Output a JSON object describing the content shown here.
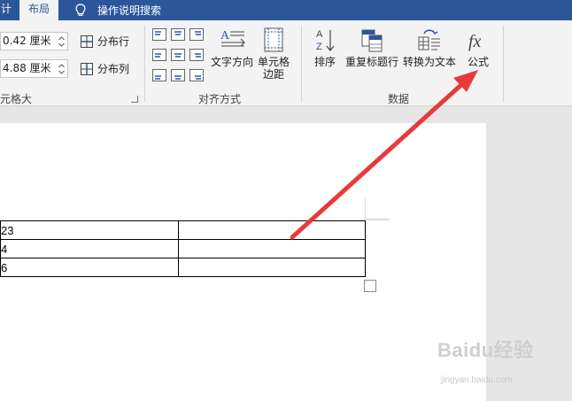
{
  "tabs": {
    "previous_partial": "计",
    "active": "布局",
    "tell_me": "操作说明搜索"
  },
  "cell_size": {
    "row_height": "0.42 厘米",
    "col_width": "4.88 厘米",
    "distribute_rows": "分布行",
    "distribute_cols": "分布列",
    "group_label": "元格大小"
  },
  "alignment": {
    "text_direction": "文字方向",
    "cell_margins_line1": "单元格",
    "cell_margins_line2": "边距",
    "group_label": "对齐方式"
  },
  "data_group": {
    "sort": "排序",
    "repeat_header": "重复标题行",
    "convert_to_text": "转换为文本",
    "formula": "公式",
    "group_label": "数据"
  },
  "table": {
    "rows": [
      [
        "23",
        ""
      ],
      [
        "4",
        ""
      ],
      [
        "6",
        ""
      ]
    ]
  },
  "watermark": {
    "text": "Baidu经验",
    "sub": "jingyan.baidu.com"
  },
  "colors": {
    "tab_bar": "#2b579a",
    "ribbon": "#f3f3f3",
    "arrow": "#e83a3a"
  }
}
